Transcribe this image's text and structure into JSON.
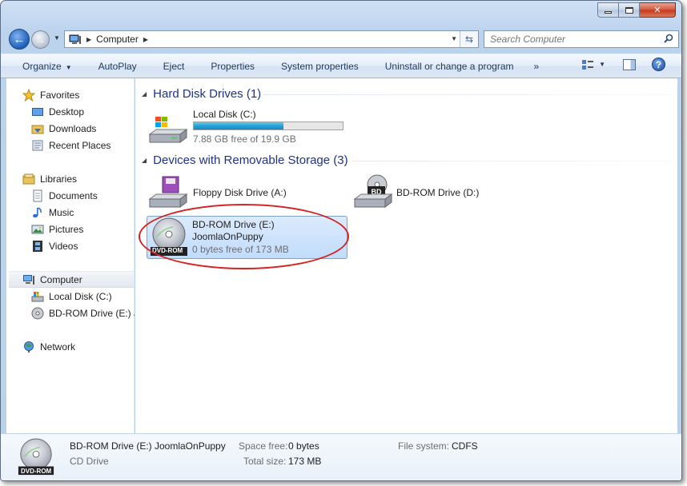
{
  "window": {
    "title": "Computer"
  },
  "nav": {
    "breadcrumb": "Computer",
    "search_placeholder": "Search Computer"
  },
  "toolbar": {
    "items": [
      "Organize",
      "AutoPlay",
      "Eject",
      "Properties",
      "System properties",
      "Uninstall or change a program"
    ],
    "more": "»"
  },
  "sidebar": {
    "favorites": {
      "label": "Favorites",
      "items": [
        "Desktop",
        "Downloads",
        "Recent Places"
      ]
    },
    "libraries": {
      "label": "Libraries",
      "items": [
        "Documents",
        "Music",
        "Pictures",
        "Videos"
      ]
    },
    "computer": {
      "label": "Computer",
      "items": [
        "Local Disk (C:)",
        "BD-ROM Drive (E:) JoomlaOnPuppy"
      ]
    },
    "network": {
      "label": "Network"
    }
  },
  "content": {
    "hdd_group": "Hard Disk Drives (1)",
    "removable_group": "Devices with Removable Storage (3)",
    "local_disk": {
      "name": "Local Disk (C:)",
      "free": "7.88 GB free of 19.9 GB",
      "used_fraction": 0.6
    },
    "floppy": {
      "name": "Floppy Disk Drive (A:)"
    },
    "bd_d": {
      "name": "BD-ROM Drive (D:)",
      "badge": "BD"
    },
    "bd_e": {
      "name": "BD-ROM Drive (E:)",
      "label": "JoomlaOnPuppy",
      "free": "0 bytes free of 173 MB",
      "badge": "DVD-ROM"
    }
  },
  "details": {
    "title": "BD-ROM Drive (E:) JoomlaOnPuppy",
    "type": "CD Drive",
    "space_free_label": "Space free:",
    "space_free": "0 bytes",
    "total_size_label": "Total size:",
    "total_size": "173 MB",
    "fs_label": "File system:",
    "fs": "CDFS",
    "badge": "DVD-ROM"
  },
  "colors": {
    "accent": "#1e3287",
    "highlight": "#d52222",
    "progress": "#26a0da"
  }
}
